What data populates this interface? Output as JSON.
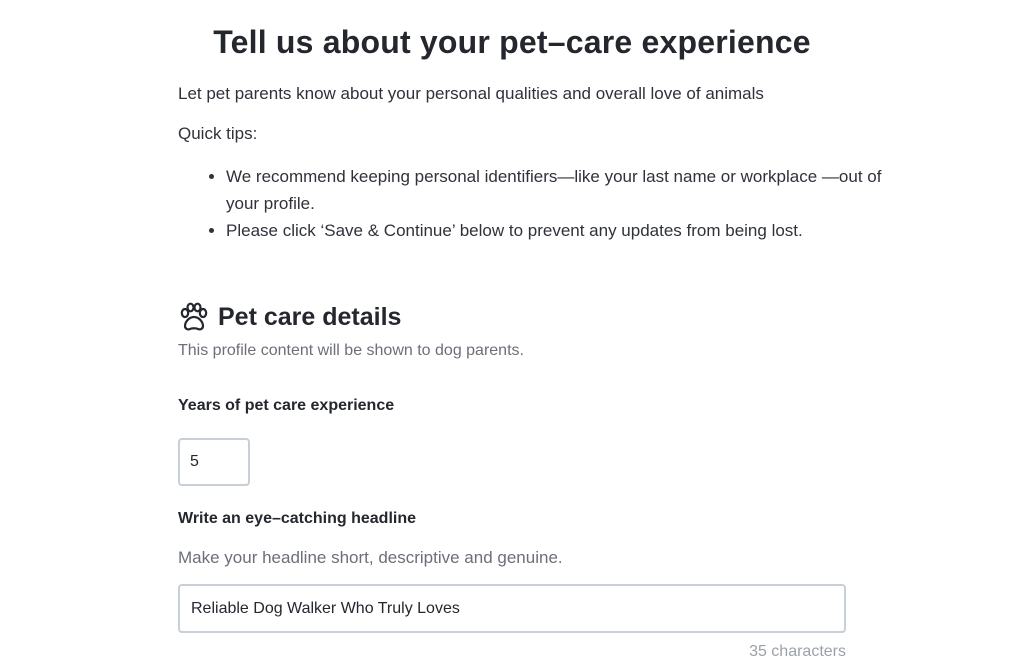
{
  "header": {
    "title": "Tell us about your pet–care experience",
    "intro": "Let pet parents know about your personal qualities and overall love of animals",
    "tips_label": "Quick tips:",
    "tips": [
      "We recommend keeping personal identifiers—like your last name or workplace —out of your profile.",
      "Please click ‘Save & Continue’ below to prevent any updates from being lost."
    ]
  },
  "section": {
    "icon": "paw-icon",
    "title": "Pet care details",
    "subtitle": "This profile content will be shown to dog parents."
  },
  "experience": {
    "label": "Years of pet care experience",
    "value": "5"
  },
  "headline": {
    "label": "Write an eye–catching headline",
    "help": "Make your headline short, descriptive and genuine.",
    "value": "Reliable Dog Walker Who Truly Loves",
    "char_count": "35 characters"
  }
}
